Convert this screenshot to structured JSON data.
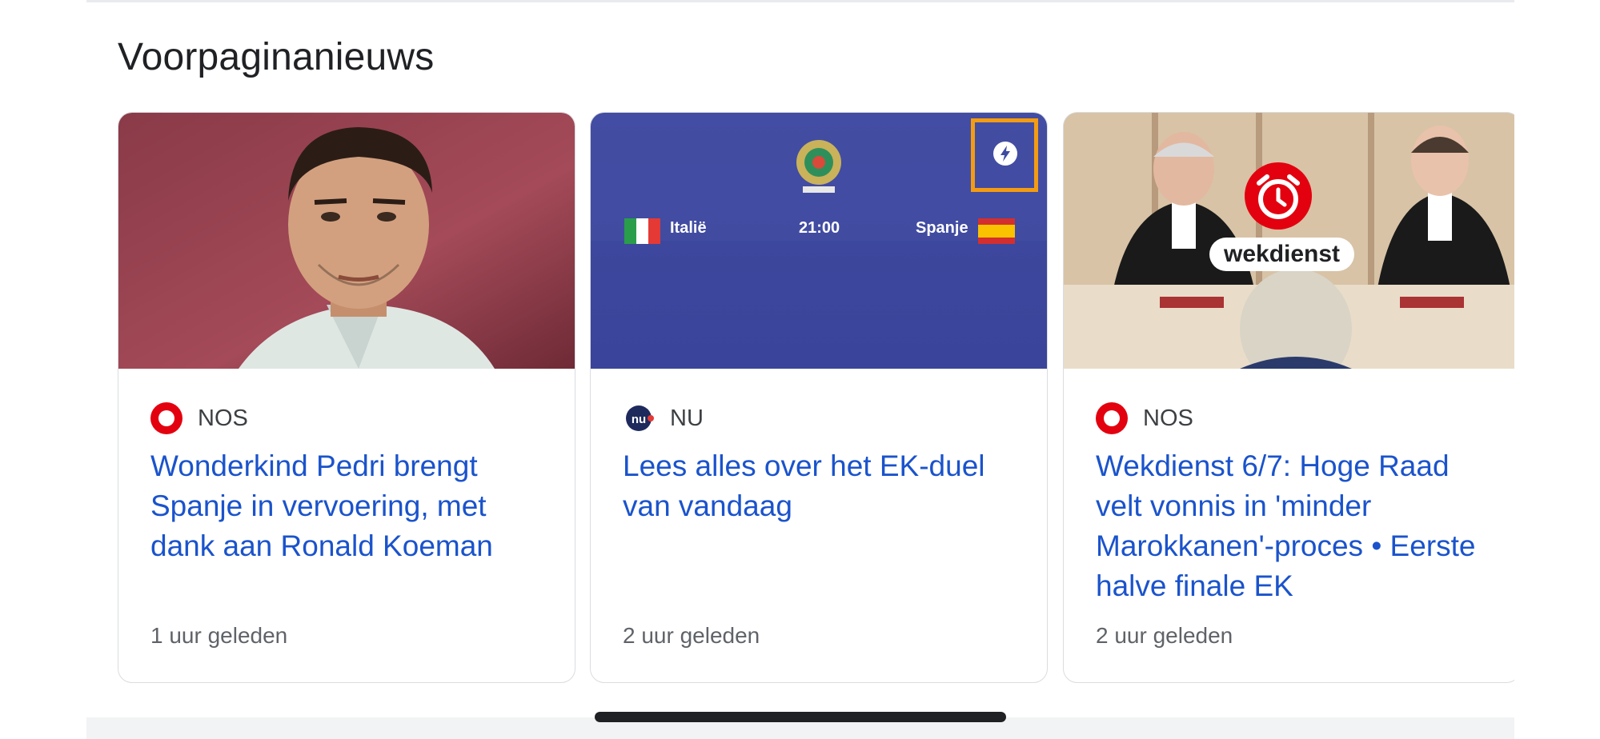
{
  "section": {
    "title": "Voorpaginanieuws"
  },
  "cards": [
    {
      "source": "NOS",
      "headline": "Wonderkind Pedri brengt Spanje in vervoering, met dank aan Ronald Koeman",
      "time": "1 uur geleden",
      "source_logo": "nos-logo-icon"
    },
    {
      "source": "NU",
      "headline": "Lees alles over het EK-duel van vandaag",
      "time": "2 uur geleden",
      "source_logo": "nu-logo-icon",
      "match": {
        "home": "Italië",
        "away": "Spanje",
        "kickoff": "21:00",
        "tournament_logo": "euro2020-logo-icon"
      },
      "badge": "amp-lightning-icon"
    },
    {
      "source": "NOS",
      "headline": "Wekdienst 6/7: Hoge Raad velt vonnis in 'minder Marokkanen'-proces • Eerste halve finale EK",
      "time": "2 uur geleden",
      "source_logo": "nos-logo-icon",
      "overlay_label": "wekdienst",
      "overlay_icon": "alarm-clock-icon"
    }
  ],
  "colors": {
    "link": "#1a53cc",
    "nos_red": "#e3000f",
    "nu_navy": "#1f2a5c",
    "highlight": "#f39c12"
  }
}
